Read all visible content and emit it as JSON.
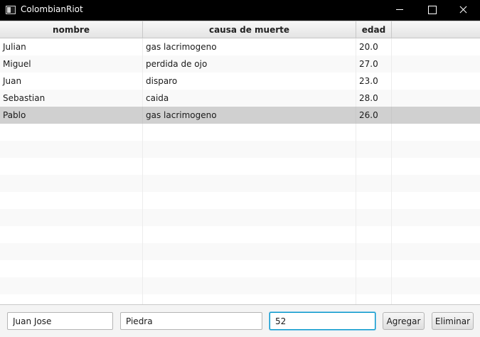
{
  "window": {
    "title": "ColombianRiot"
  },
  "table": {
    "columns": [
      "nombre",
      "causa de muerte",
      "edad"
    ],
    "rows": [
      {
        "nombre": "Julian",
        "causa": "gas lacrimogeno",
        "edad": "20.0"
      },
      {
        "nombre": "Miguel",
        "causa": "perdida de ojo",
        "edad": "27.0"
      },
      {
        "nombre": "Juan",
        "causa": "disparo",
        "edad": "23.0"
      },
      {
        "nombre": "Sebastian",
        "causa": "caida",
        "edad": "28.0"
      },
      {
        "nombre": "Pablo",
        "causa": "gas lacrimogeno",
        "edad": "26.0"
      }
    ],
    "selected_row": 4
  },
  "form": {
    "nombre_value": "Juan Jose",
    "causa_value": "Piedra",
    "edad_value": "52",
    "agregar_label": "Agregar",
    "eliminar_label": "Eliminar"
  }
}
